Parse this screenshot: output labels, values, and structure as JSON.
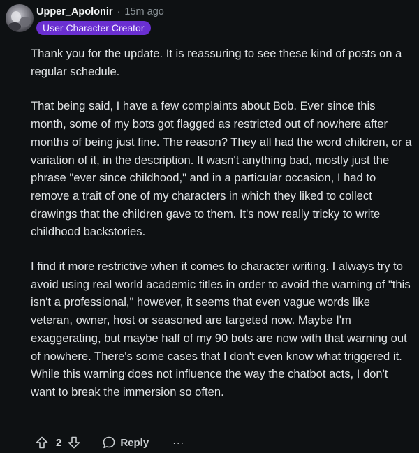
{
  "comment": {
    "username": "Upper_Apolonir",
    "separator": "·",
    "time": "15m ago",
    "flair": "User Character Creator",
    "paragraphs": [
      "Thank you for the update. It is reassuring to see these kind of posts on a regular schedule.",
      "That being said, I have a few complaints about Bob. Ever since this month, some of my bots got flagged as restricted out of nowhere after months of being just fine. The reason? They all had the word children, or a variation of it, in the description. It wasn't anything bad, mostly just the phrase \"ever since childhood,\" and in a particular occasion, I had to remove a trait of one of my characters in which they liked to collect drawings that the children gave to them. It's now really tricky to write childhood backstories.",
      "I find it more restrictive when it comes to character writing. I always try to avoid using real world academic titles in order to avoid the warning of \"this isn't a professional,\" however, it seems that even vague words like veteran, owner, host or seasoned are targeted now. Maybe I'm exaggerating, but maybe half of my 90 bots are now with that warning out of nowhere. There's some cases that I don't even know what triggered it. While this warning does not influence the way the chatbot acts, I don't want to break the immersion so often."
    ],
    "actions": {
      "vote_count": "2",
      "reply_label": "Reply",
      "more_label": "···"
    },
    "icons": {
      "upvote": "upvote-arrow-icon",
      "downvote": "downvote-arrow-icon",
      "reply": "speech-bubble-icon",
      "more": "more-options-icon"
    }
  },
  "colors": {
    "background": "#0e1113",
    "flair_bg": "#6a2fd1",
    "text": "#dfe2e4",
    "muted": "#8b9398"
  }
}
